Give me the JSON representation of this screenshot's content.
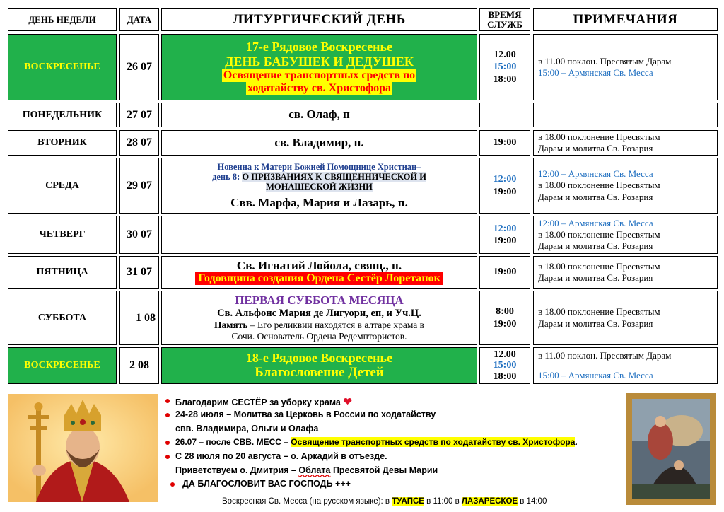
{
  "headers": {
    "day": "ДЕНЬ НЕДЕЛИ",
    "date": "ДАТА",
    "liturgical": "ЛИТУРГИЧЕСКИЙ ДЕНЬ",
    "time_line1": "ВРЕМЯ",
    "time_line2": "СЛУЖБ",
    "notes": "ПРИМЕЧАНИЯ"
  },
  "rows": [
    {
      "day": "ВОСКРЕСЕНЬЕ",
      "date": "26 07",
      "lit_line1": "17-е Рядовое Воскресенье",
      "lit_line2": "ДЕНЬ БАБУШЕК И ДЕДУШЕК",
      "lit_line3": "Освящение транспортных средств по",
      "lit_line4": "ходатайству св. Христофора",
      "times": [
        "12.00",
        "15:00",
        "18:00"
      ],
      "note1": "в 11.00 поклон. Пресвятым Дарам",
      "note2": "15:00 – Армянская Св. Месса"
    },
    {
      "day": "ПОНЕДЕЛЬНИК",
      "date": "27 07",
      "lit": "св. Олаф, п"
    },
    {
      "day": "ВТОРНИК",
      "date": "28 07",
      "lit": "св. Владимир, п.",
      "time": "19:00",
      "note1": "в 18.00 поклонение Пресвятым",
      "note2": "Дарам и молитва Св. Розария"
    },
    {
      "day": "СРЕДА",
      "date": "29 07",
      "novena1": "Новенна к Матери Божией Помощнице Христиан–",
      "novena2a": "день 8: ",
      "novena2b": "О ПРИЗВАНИЯХ К СВЯЩЕННИЧЕСКОЙ И",
      "novena3": "МОНАШЕСКОЙ ЖИЗНИ",
      "lit": "Свв. Марфа, Мария и Лазарь, п.",
      "times": [
        "12:00",
        "19:00"
      ],
      "note1": "12:00 – Армянская Св. Месса",
      "note2": "в 18.00 поклонение Пресвятым",
      "note3": "Дарам и молитва Св. Розария"
    },
    {
      "day": "ЧЕТВЕРГ",
      "date": "30 07",
      "times": [
        "12:00",
        "19:00"
      ],
      "note1": "12:00 – Армянская Св. Месса",
      "note2": "в 18.00 поклонение Пресвятым",
      "note3": "Дарам и молитва Св. Розария"
    },
    {
      "day": "ПЯТНИЦА",
      "date": "31 07",
      "lit": "Св. Игнатий Лойола, свящ., п.",
      "lit_red": "Годовщина создания Ордена Сестёр Лоретанок",
      "time": "19:00",
      "note1": "в 18.00 поклонение Пресвятым",
      "note2": "Дарам и молитва Св. Розария"
    },
    {
      "day": "СУББОТА",
      "date": "1 08",
      "lit_purple": "ПЕРВАЯ СУББОТА МЕСЯЦА",
      "lit_line2": "Св. Альфонс Мария де Лигуори, еп, и Уч.Ц.",
      "lit_line3a": "Память",
      "lit_line3b": " – Его реликвии находятся в алтаре храма в",
      "lit_line4": "Сочи. Основатель Ордена Редемптористов.",
      "times": [
        "8:00",
        "19:00"
      ],
      "note1": "в 18.00 поклонение Пресвятым",
      "note2": "Дарам и молитва Св. Розария"
    },
    {
      "day": "ВОСКРЕСЕНЬЕ",
      "date": "2 08",
      "lit_line1": "18-е Рядовое Воскресенье",
      "lit_line2": "Благословение Детей",
      "times": [
        "12.00",
        "15:00",
        "18:00"
      ],
      "note1": "в 11.00 поклон. Пресвятым Дарам",
      "note2": "15:00 – Армянская Св. Месса"
    }
  ],
  "bullets": {
    "b1": "Благодарим СЕСТЁР за уборку храма",
    "b2": "24-28 июля – Молитва за Церковь в России по ходатайству",
    "b2_cont": "свв. Владимира, Ольги и Олафа",
    "b3a": "26.07 – после СВВ. МЕСС – ",
    "b3b": "Освящение транспортных средств по ходатайству св. Христофора",
    "b3c": ".",
    "b4": "С 28 июля по 20 августа – о. Аркадий в отъезде.",
    "b4_cont_a": "Приветствуем о. Дмитрия – ",
    "b4_cont_b": "Облата",
    "b4_cont_c": " Пресвятой Девы Марии",
    "b5": "ДА БЛАГОСЛОВИТ ВАС ГОСПОДЬ +++"
  },
  "footer": {
    "a": "Воскресная Св. Месса (на русском языке): в ",
    "b": "ТУАПСЕ",
    "c": " в 11:00 в ",
    "d": "ЛАЗАРЕСКОЕ",
    "e": " в 14:00"
  },
  "colors": {
    "green": "#21b14b",
    "yellow": "#ffff00",
    "red": "#ff0000",
    "blue": "#1f6fc0",
    "purple": "#7030a0"
  }
}
